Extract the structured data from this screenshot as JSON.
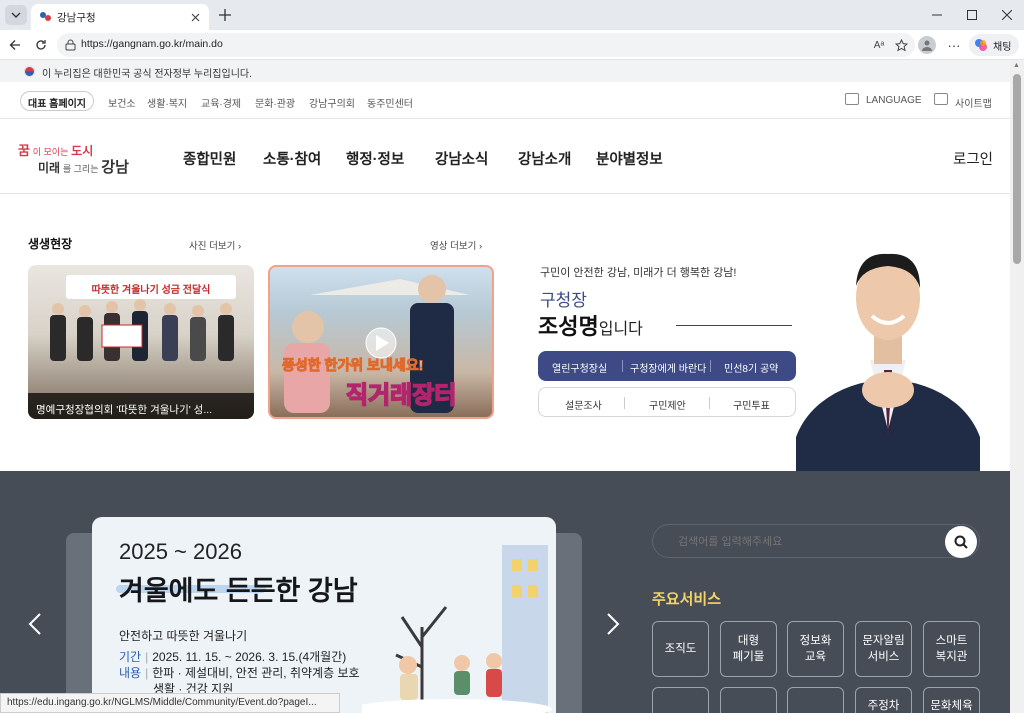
{
  "browser": {
    "tab_title": "강남구청",
    "url": "https://gangnam.go.kr/main.do",
    "chat_label": "채팅",
    "status_url": "https://edu.ingang.go.kr/NGLMS/Middle/Community/Event.do?pageI..."
  },
  "gov_banner": "이 누리집은 대한민국 공식 전자정부 누리집입니다.",
  "top_nav": {
    "home_button": "대표 홈페이지",
    "links": [
      "보건소",
      "생활·복지",
      "교육·경제",
      "문화·관광",
      "강남구의회",
      "동주민센터"
    ],
    "language": "LANGUAGE",
    "sitemap": "사이트맵"
  },
  "logo": {
    "line1a": "꿈",
    "line1b": "이 모이는",
    "line1c": "도시",
    "line2a": "미래",
    "line2b": "를 그리는",
    "line2c": "강남"
  },
  "main_menu": [
    "종합민원",
    "소통·참여",
    "행정·정보",
    "강남소식",
    "강남소개",
    "분야별정보"
  ],
  "login": "로그인",
  "live": {
    "title": "생생현장",
    "photo_more": "사진 더보기",
    "video_more": "영상 더보기",
    "photo_caption": "명예구청장협의회 '따뜻한 겨울나기' 성...",
    "photo_banner": "따뜻한 겨울나기 성금 전달식",
    "video_line1": "풍성한 한가위 보내세요!",
    "video_line2": "직거래장터"
  },
  "mayor": {
    "slogan": "구민이 안전한 강남, 미래가 더 행복한 강남!",
    "title": "구청장",
    "name": "조성명",
    "name_suffix": "입니다",
    "links_primary": [
      "열린구청장실",
      "구청장에게 바란다",
      "민선8기 공약"
    ],
    "links_secondary": [
      "설문조사",
      "구민제안",
      "구민투표"
    ]
  },
  "banner": {
    "years": "2025 ~ 2026",
    "headline": "겨울에도 든든한 강남",
    "sub": "안전하고 따뜻한 겨울나기",
    "period_label": "기간",
    "period": "2025. 11. 15. ~ 2026. 3. 15.(4개월간)",
    "content_label": "내용",
    "content_line1": "한파 · 제설대비, 안전 관리, 취약계층 보호",
    "content_line2": "생활 · 건강 지원"
  },
  "search": {
    "placeholder": "검색어를 입력해주세요"
  },
  "services": {
    "title": "주요서비스",
    "items": [
      {
        "l1": "조직도",
        "l2": ""
      },
      {
        "l1": "대형",
        "l2": "폐기물"
      },
      {
        "l1": "정보화",
        "l2": "교육"
      },
      {
        "l1": "문자알림",
        "l2": "서비스"
      },
      {
        "l1": "스마트",
        "l2": "복지관"
      }
    ],
    "partial": [
      "주정차",
      "문화체육"
    ]
  },
  "colors": {
    "dark_section": "#464d56",
    "mayor_button": "#3d4a86",
    "service_title": "#f4d36a",
    "logo_red": "#d83a4a"
  }
}
